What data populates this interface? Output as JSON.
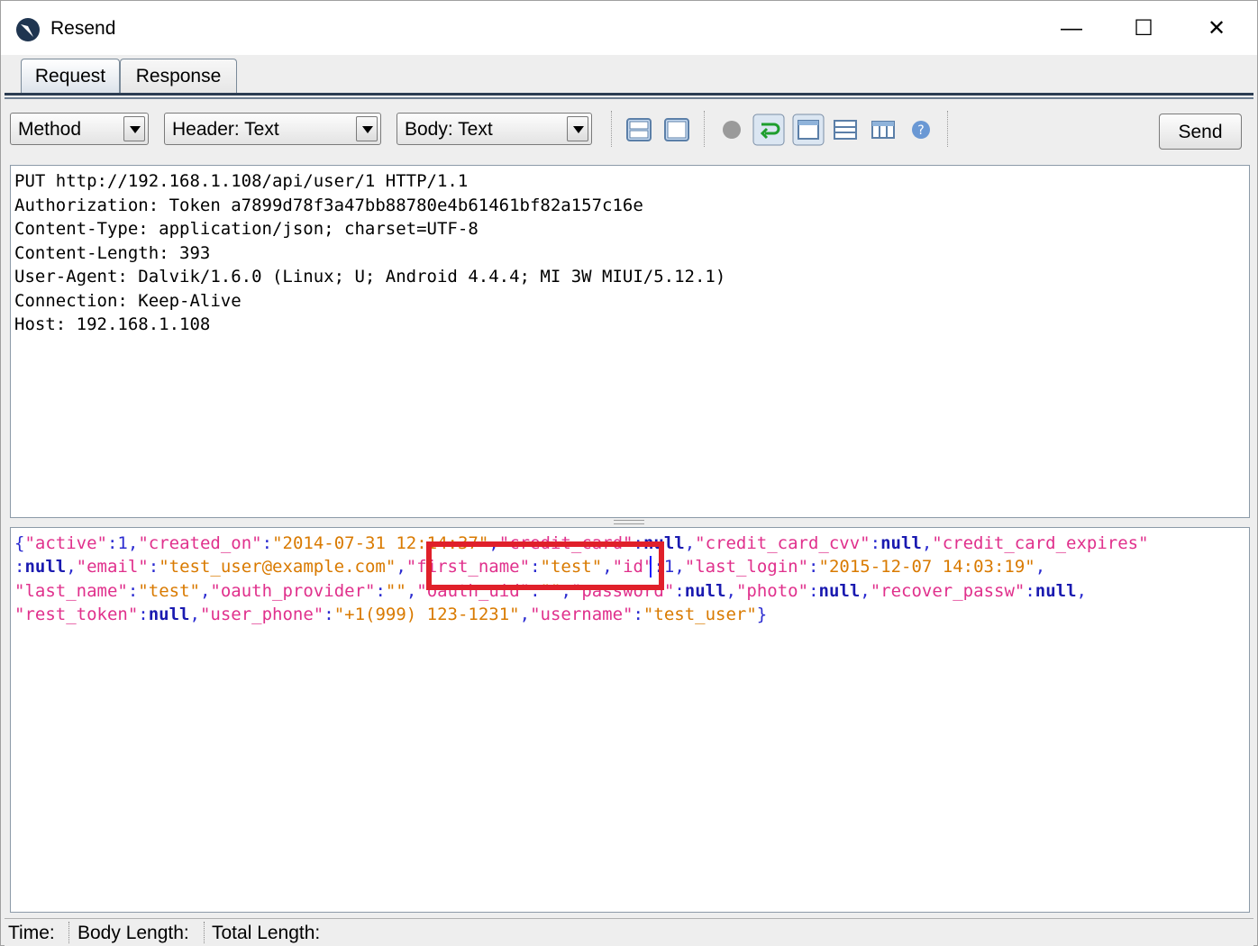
{
  "window": {
    "title": "Resend"
  },
  "controls": {
    "minimize": "—",
    "maximize": "☐",
    "close": "✕"
  },
  "tabs": [
    {
      "label": "Request",
      "active": true
    },
    {
      "label": "Response",
      "active": false
    }
  ],
  "toolbar": {
    "method_label": "Method",
    "header_label": "Header: Text",
    "body_label": "Body: Text",
    "send_label": "Send"
  },
  "request_lines": [
    "PUT http://192.168.1.108/api/user/1 HTTP/1.1",
    "Authorization: Token a7899d78f3a47bb88780e4b61461bf82a157c16e",
    "Content-Type: application/json; charset=UTF-8",
    "Content-Length: 393",
    "User-Agent: Dalvik/1.6.0 (Linux; U; Android 4.4.4; MI 3W MIUI/5.12.1)",
    "Connection: Keep-Alive",
    "Host: 192.168.1.108"
  ],
  "body_json": {
    "active": "1",
    "created_on": "2014-07-31 12:14:37",
    "credit_card": "null",
    "credit_card_cvv": "null",
    "credit_card_expires": "null",
    "email": "test_user@example.com",
    "first_name": "test",
    "id": "1",
    "last_login": "2015-12-07 14:03:19",
    "last_name": "test",
    "oauth_provider": "",
    "oauth_uid": "",
    "password": "null",
    "photo": "null",
    "recover_passw": "null",
    "rest_token": "null",
    "user_phone": "+1(999) 123-1231",
    "username": "test_user"
  },
  "status": {
    "time_label": "Time:",
    "body_length_label": "Body Length:",
    "total_length_label": "Total Length:"
  }
}
